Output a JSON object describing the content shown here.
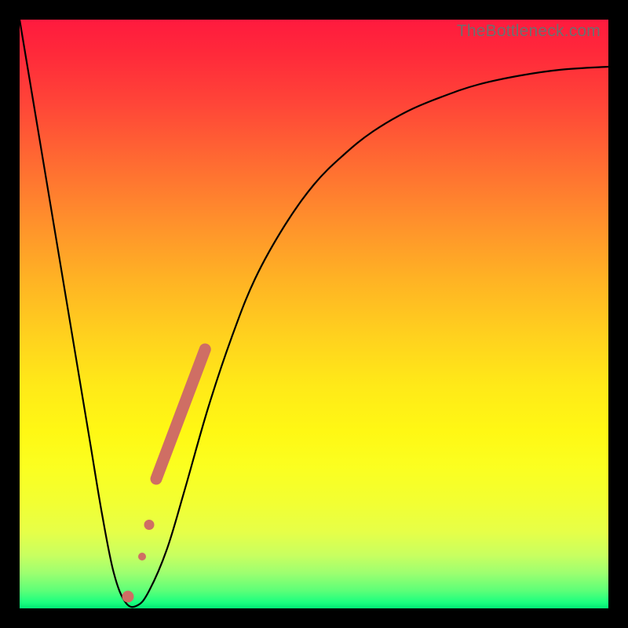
{
  "watermark": "TheBottleneck.com",
  "chart_data": {
    "type": "line",
    "title": "",
    "xlabel": "",
    "ylabel": "",
    "xlim": [
      0,
      100
    ],
    "ylim": [
      0,
      100
    ],
    "series": [
      {
        "name": "bottleneck-curve",
        "x": [
          0,
          2,
          4,
          6,
          8,
          10,
          12,
          14,
          16,
          18,
          20,
          22,
          25,
          28,
          32,
          36,
          40,
          45,
          50,
          55,
          60,
          66,
          72,
          78,
          85,
          92,
          100
        ],
        "values": [
          100,
          88,
          76,
          64,
          52,
          40,
          28,
          16,
          6,
          1,
          0.5,
          3,
          10,
          20,
          34,
          46,
          56,
          65,
          72,
          77,
          81,
          84.5,
          87,
          89,
          90.5,
          91.5,
          92
        ]
      }
    ],
    "markers": [
      {
        "name": "thick-segment",
        "x_start": 23.2,
        "y_start": 22,
        "x_end": 31.5,
        "y_end": 44,
        "color": "#cf6e64",
        "width": 15
      },
      {
        "name": "dot-upper",
        "x": 22.0,
        "y": 14.2,
        "r": 6.5,
        "color": "#cf6e64"
      },
      {
        "name": "dot-mid",
        "x": 20.8,
        "y": 8.8,
        "r": 5.0,
        "color": "#cf6e64"
      },
      {
        "name": "dot-low",
        "x": 18.4,
        "y": 2.0,
        "r": 7.5,
        "color": "#cf6e64"
      }
    ]
  }
}
